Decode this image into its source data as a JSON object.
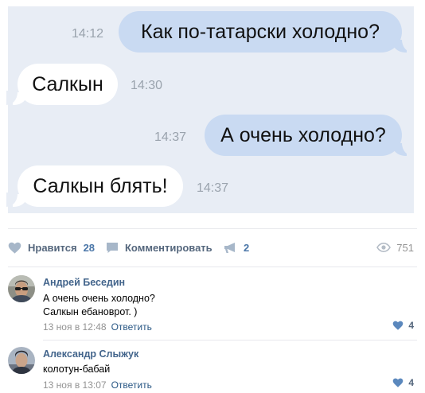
{
  "chat": {
    "messages": [
      {
        "direction": "out",
        "text": "Как по-татарски холодно?",
        "time": "14:12"
      },
      {
        "direction": "in",
        "text": "Салкын",
        "time": "14:30"
      },
      {
        "direction": "out",
        "text": "А очень холодно?",
        "time": "14:37"
      },
      {
        "direction": "in",
        "text": "Салкын блять!",
        "time": "14:37"
      }
    ]
  },
  "actions": {
    "like_label": "Нравится",
    "like_count": "28",
    "comment_label": "Комментировать",
    "share_count": "2",
    "views_count": "751",
    "icons": [
      "heart-icon",
      "comment-icon",
      "megaphone-icon",
      "eye-icon"
    ]
  },
  "comments": [
    {
      "author": "Андрей Беседин",
      "lines": [
        "А очень очень холодно?",
        "Салкын ебановрот. )"
      ],
      "date": "13 ноя в 12:48",
      "reply_label": "Ответить",
      "likes": "4"
    },
    {
      "author": "Александр Слыжук",
      "lines": [
        "колотун-бабай"
      ],
      "date": "13 ноя в 13:07",
      "reply_label": "Ответить",
      "likes": "4"
    }
  ],
  "colors": {
    "chat_background": "#e8edf5",
    "outgoing_bubble": "#c9daf2",
    "incoming_bubble": "#ffffff",
    "link": "#42648b",
    "action_text": "#55677d",
    "heart_accent": "#5b88bd"
  }
}
